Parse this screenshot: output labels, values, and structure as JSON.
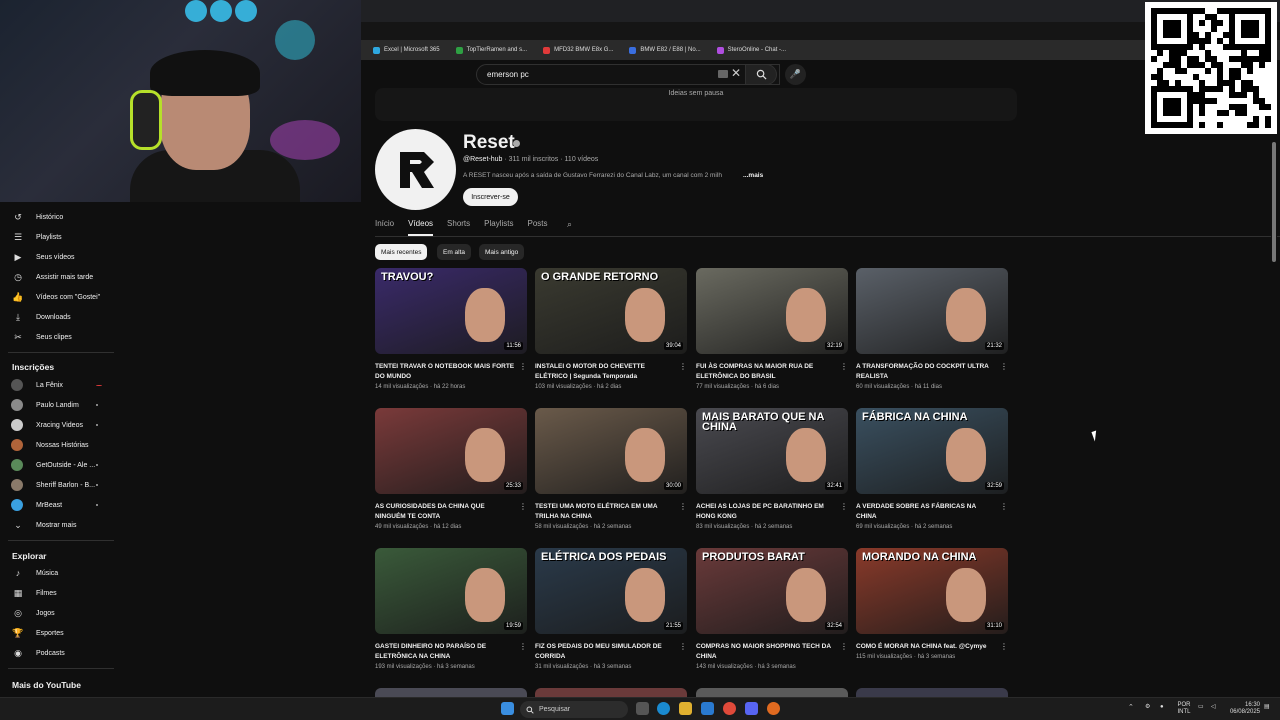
{
  "browser": {
    "bookmarks": [
      {
        "label": "Excel | Microsoft 365",
        "color": "#2ea8e0"
      },
      {
        "label": "TopTierRamen and s...",
        "color": "#2ea043"
      },
      {
        "label": "MFD32 BMW E8x G...",
        "color": "#e03a3a"
      },
      {
        "label": "BMW E82 / E88 | No...",
        "color": "#3a6ee0"
      },
      {
        "label": "SteroOnline - Chat -...",
        "color": "#b04ee0"
      }
    ]
  },
  "search": {
    "query": "emerson pc"
  },
  "banner": {
    "text": "Ideias sem pausa"
  },
  "sidebar": {
    "you_items": [
      {
        "label": "Histórico",
        "icon": "↺"
      },
      {
        "label": "Playlists",
        "icon": "☰"
      },
      {
        "label": "Seus vídeos",
        "icon": "▶"
      },
      {
        "label": "Assistir mais tarde",
        "icon": "◷"
      },
      {
        "label": "Vídeos com \"Gostei\"",
        "icon": "👍"
      },
      {
        "label": "Downloads",
        "icon": "⤓"
      },
      {
        "label": "Seus clipes",
        "icon": "✂"
      }
    ],
    "subscriptions_title": "Inscrições",
    "subscriptions": [
      {
        "label": "La Fênix",
        "color": "#555555"
      },
      {
        "label": "Paulo Landim",
        "color": "#8a8a8a"
      },
      {
        "label": "Xracing Videos",
        "color": "#cccccc"
      },
      {
        "label": "Nossas Histórias",
        "color": "#b0643a"
      },
      {
        "label": "GetOutside - Ale ...",
        "color": "#5a8a5a"
      },
      {
        "label": "Sheriff Barlon - B...",
        "color": "#8a7a6a"
      },
      {
        "label": "MrBeast",
        "color": "#3aa0e0"
      }
    ],
    "show_more": "Mostrar mais",
    "explore_title": "Explorar",
    "explore": [
      {
        "label": "Música",
        "icon": "♪"
      },
      {
        "label": "Filmes",
        "icon": "▦"
      },
      {
        "label": "Jogos",
        "icon": "◎"
      },
      {
        "label": "Esportes",
        "icon": "🏆"
      },
      {
        "label": "Podcasts",
        "icon": "◉"
      }
    ],
    "more_title": "Mais do YouTube"
  },
  "channel": {
    "name": "Reset",
    "handle": "@Reset-hub",
    "subscribers": "311 mil inscritos",
    "videos_count": "110 vídeos",
    "description": "A RESET nasceu após a saída de Gustavo Ferrarezi do Canal Labz, um canal com 2 milh",
    "more": "...mais",
    "subscribe": "Inscrever-se"
  },
  "tabs": [
    "Início",
    "Vídeos",
    "Shorts",
    "Playlists",
    "Posts"
  ],
  "chips": [
    "Mais recentes",
    "Em alta",
    "Mais antigo"
  ],
  "videos": [
    {
      "title": "TENTEI TRAVAR O NOTEBOOK MAIS FORTE DO MUNDO",
      "views": "14 mil visualizações",
      "age": "há 22 horas",
      "duration": "11:56",
      "overlay": "TRAVOU?",
      "bg": "#3a2a6a"
    },
    {
      "title": "INSTALEI O MOTOR DO CHEVETTE ELÉTRICO | Segunda Temporada",
      "views": "103 mil visualizações",
      "age": "há 2 dias",
      "duration": "39:04",
      "overlay": "O GRANDE RETORNO",
      "bg": "#3a3a30"
    },
    {
      "title": "FUI ÀS COMPRAS NA MAIOR RUA DE ELETRÔNICA DO BRASIL",
      "views": "77 mil visualizações",
      "age": "há 6 dias",
      "duration": "32:19",
      "overlay": "",
      "bg": "#6a6a60"
    },
    {
      "title": "A TRANSFORMAÇÃO DO COCKPIT ULTRA REALISTA",
      "views": "60 mil visualizações",
      "age": "há 11 dias",
      "duration": "21:32",
      "overlay": "",
      "bg": "#5a6068"
    },
    {
      "title": "AS CURIOSIDADES DA CHINA QUE NINGUÉM TE CONTA",
      "views": "49 mil visualizações",
      "age": "há 12 dias",
      "duration": "25:33",
      "overlay": "",
      "bg": "#7a3a3a"
    },
    {
      "title": "TESTEI UMA MOTO ELÉTRICA EM UMA TRILHA NA CHINA",
      "views": "58 mil visualizações",
      "age": "há 2 semanas",
      "duration": "30:00",
      "overlay": "",
      "bg": "#6a5a4a"
    },
    {
      "title": "ACHEI AS LOJAS DE PC BARATINHO EM HONG KONG",
      "views": "83 mil visualizações",
      "age": "há 2 semanas",
      "duration": "32:41",
      "overlay": "MAIS BARATO QUE NA CHINA",
      "bg": "#4a4a50"
    },
    {
      "title": "A VERDADE SOBRE AS FÁBRICAS NA CHINA",
      "views": "69 mil visualizações",
      "age": "há 2 semanas",
      "duration": "32:59",
      "overlay": "FÁBRICA NA CHINA",
      "bg": "#3a5060"
    },
    {
      "title": "GASTEI DINHEIRO NO PARAÍSO DE ELETRÔNICA NA CHINA",
      "views": "193 mil visualizações",
      "age": "há 3 semanas",
      "duration": "19:59",
      "overlay": "",
      "bg": "#3a5a3a"
    },
    {
      "title": "FIZ OS PEDAIS DO MEU SIMULADOR DE CORRIDA",
      "views": "31 mil visualizações",
      "age": "há 3 semanas",
      "duration": "21:55",
      "overlay": "ELÉTRICA DOS PEDAIS",
      "bg": "#2a3a4a"
    },
    {
      "title": "COMPRAS NO MAIOR SHOPPING TECH DA CHINA",
      "views": "143 mil visualizações",
      "age": "há 3 semanas",
      "duration": "32:54",
      "overlay": "PRODUTOS BARAT",
      "bg": "#6a3a3a"
    },
    {
      "title": "COMO É MORAR NA CHINA feat. @Cymye",
      "views": "115 mil visualizações",
      "age": "há 3 semanas",
      "duration": "31:10",
      "overlay": "MORANDO NA CHINA",
      "bg": "#8a3a2a"
    }
  ],
  "taskbar": {
    "search": "Pesquisar",
    "lang_top": "POR",
    "lang_bottom": "INTL",
    "time": "16:30",
    "date": "06/08/2025"
  }
}
